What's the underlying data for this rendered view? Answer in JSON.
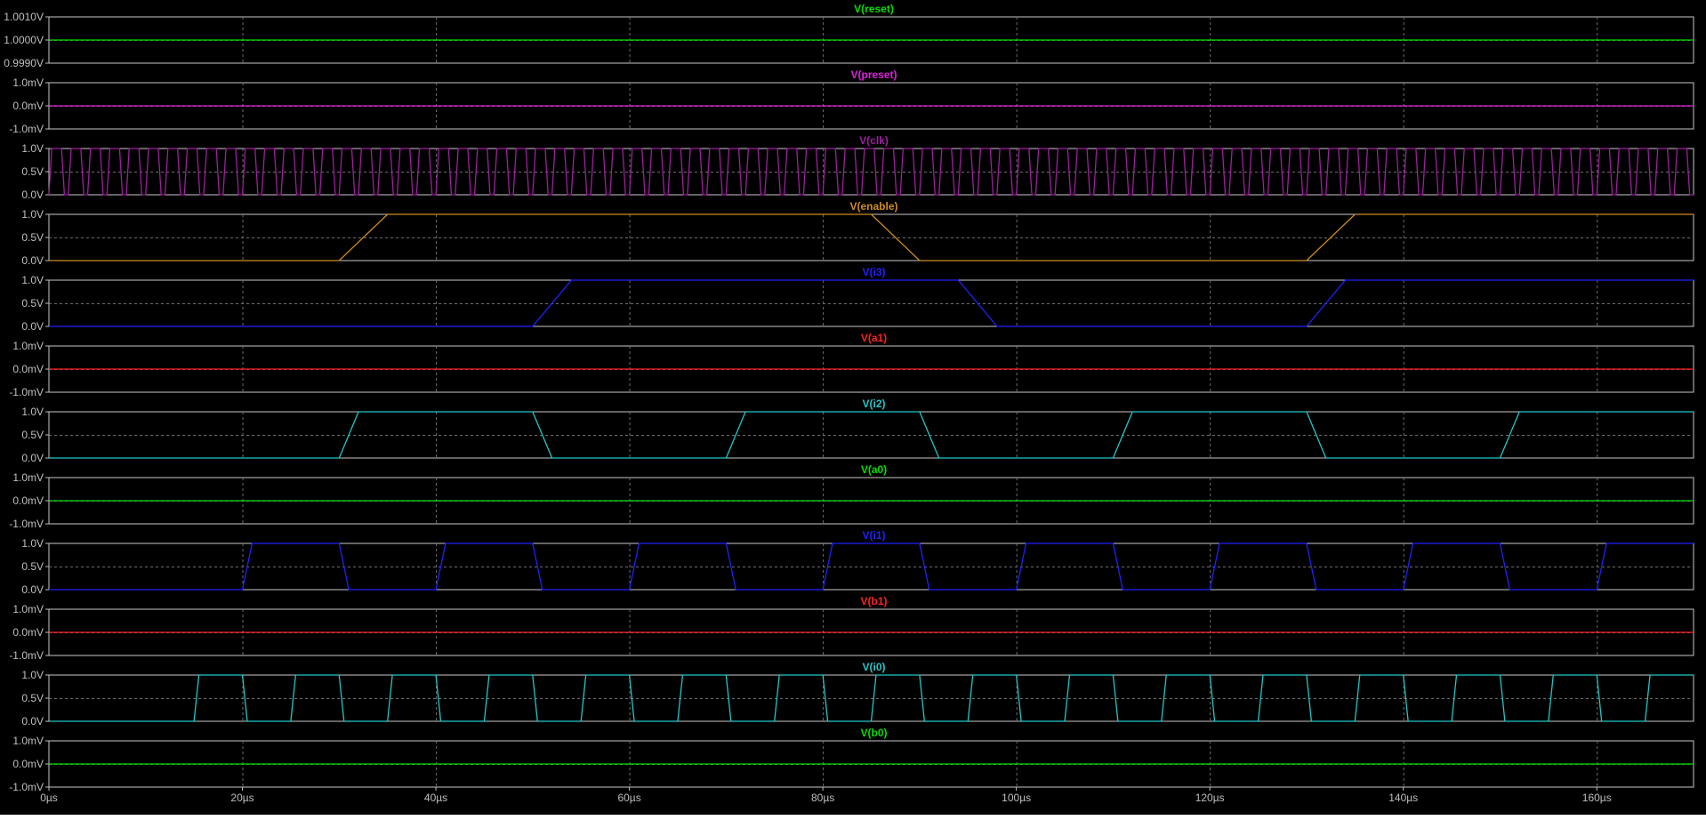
{
  "chart_data": {
    "type": "line",
    "x_unit": "µs",
    "xlim": [
      0,
      170
    ],
    "x_ticks": [
      0,
      20,
      40,
      60,
      80,
      100,
      120,
      140,
      160
    ],
    "x_tick_labels": [
      "0µs",
      "20µs",
      "40µs",
      "60µs",
      "80µs",
      "100µs",
      "120µs",
      "140µs",
      "160µs"
    ],
    "grid": true,
    "background": "#000000",
    "plot_border": "#c8c8c8",
    "panes": [
      {
        "title": "V(reset)",
        "color": "#00e000",
        "yticks": [
          "1.0010V",
          "1.0000V",
          "0.9990V"
        ],
        "ylim": [
          0.999,
          1.001
        ],
        "wave": {
          "kind": "const",
          "value": 1.0
        }
      },
      {
        "title": "V(preset)",
        "color": "#e020e0",
        "yticks": [
          "1.0mV",
          "0.0mV",
          "-1.0mV"
        ],
        "ylim": [
          -0.001,
          0.001
        ],
        "wave": {
          "kind": "const",
          "value": 0
        }
      },
      {
        "title": "V(clk)",
        "color": "#a01ea0",
        "yticks": [
          "1.0V",
          "0.5V",
          "0.0V"
        ],
        "ylim": [
          0,
          1
        ],
        "wave": {
          "kind": "pulse",
          "delay": 0,
          "rise": 0.3,
          "fall": 0.3,
          "high": 1.0,
          "period": 2.0,
          "until": 170
        }
      },
      {
        "title": "V(enable)",
        "color": "#d08c1e",
        "yticks": [
          "1.0V",
          "0.5V",
          "0.0V"
        ],
        "ylim": [
          0,
          1
        ],
        "wave": {
          "kind": "points",
          "x": [
            0,
            30,
            35,
            85,
            90,
            130,
            135,
            170
          ],
          "y": [
            0,
            0,
            1,
            1,
            0,
            0,
            1,
            1
          ]
        }
      },
      {
        "title": "V(i3)",
        "color": "#2020ff",
        "yticks": [
          "1.0V",
          "0.5V",
          "0.0V"
        ],
        "ylim": [
          0,
          1
        ],
        "wave": {
          "kind": "points",
          "x": [
            0,
            50,
            54,
            94,
            98,
            130,
            134,
            170
          ],
          "y": [
            0,
            0,
            1,
            1,
            0,
            0,
            1,
            1
          ]
        }
      },
      {
        "title": "V(a1)",
        "color": "#ff2020",
        "yticks": [
          "1.0mV",
          "0.0mV",
          "-1.0mV"
        ],
        "ylim": [
          -0.001,
          0.001
        ],
        "wave": {
          "kind": "const",
          "value": 0
        }
      },
      {
        "title": "V(i2)",
        "color": "#20c8c8",
        "yticks": [
          "1.0V",
          "0.5V",
          "0.0V"
        ],
        "ylim": [
          0,
          1
        ],
        "wave": {
          "kind": "pulse",
          "delay": 30,
          "rise": 2,
          "fall": 2,
          "high": 18,
          "period": 40,
          "until": 170
        }
      },
      {
        "title": "V(a0)",
        "color": "#00e000",
        "yticks": [
          "1.0mV",
          "0.0mV",
          "-1.0mV"
        ],
        "ylim": [
          -0.001,
          0.001
        ],
        "wave": {
          "kind": "const",
          "value": 0
        }
      },
      {
        "title": "V(i1)",
        "color": "#2020ff",
        "yticks": [
          "1.0V",
          "0.5V",
          "0.0V"
        ],
        "ylim": [
          0,
          1
        ],
        "wave": {
          "kind": "pulse",
          "delay": 20,
          "rise": 1,
          "fall": 1,
          "high": 9,
          "period": 20,
          "until": 170
        }
      },
      {
        "title": "V(b1)",
        "color": "#ff2020",
        "yticks": [
          "1.0mV",
          "0.0mV",
          "-1.0mV"
        ],
        "ylim": [
          -0.001,
          0.001
        ],
        "wave": {
          "kind": "const",
          "value": 0
        }
      },
      {
        "title": "V(i0)",
        "color": "#20c8c8",
        "yticks": [
          "1.0V",
          "0.5V",
          "0.0V"
        ],
        "ylim": [
          0,
          1
        ],
        "wave": {
          "kind": "pulse",
          "delay": 15,
          "rise": 0.5,
          "fall": 0.5,
          "high": 4.5,
          "period": 10,
          "until": 170
        }
      },
      {
        "title": "V(b0)",
        "color": "#00e000",
        "yticks": [
          "1.0mV",
          "0.0mV",
          "-1.0mV"
        ],
        "ylim": [
          -0.001,
          0.001
        ],
        "wave": {
          "kind": "const",
          "value": 0
        }
      }
    ]
  }
}
